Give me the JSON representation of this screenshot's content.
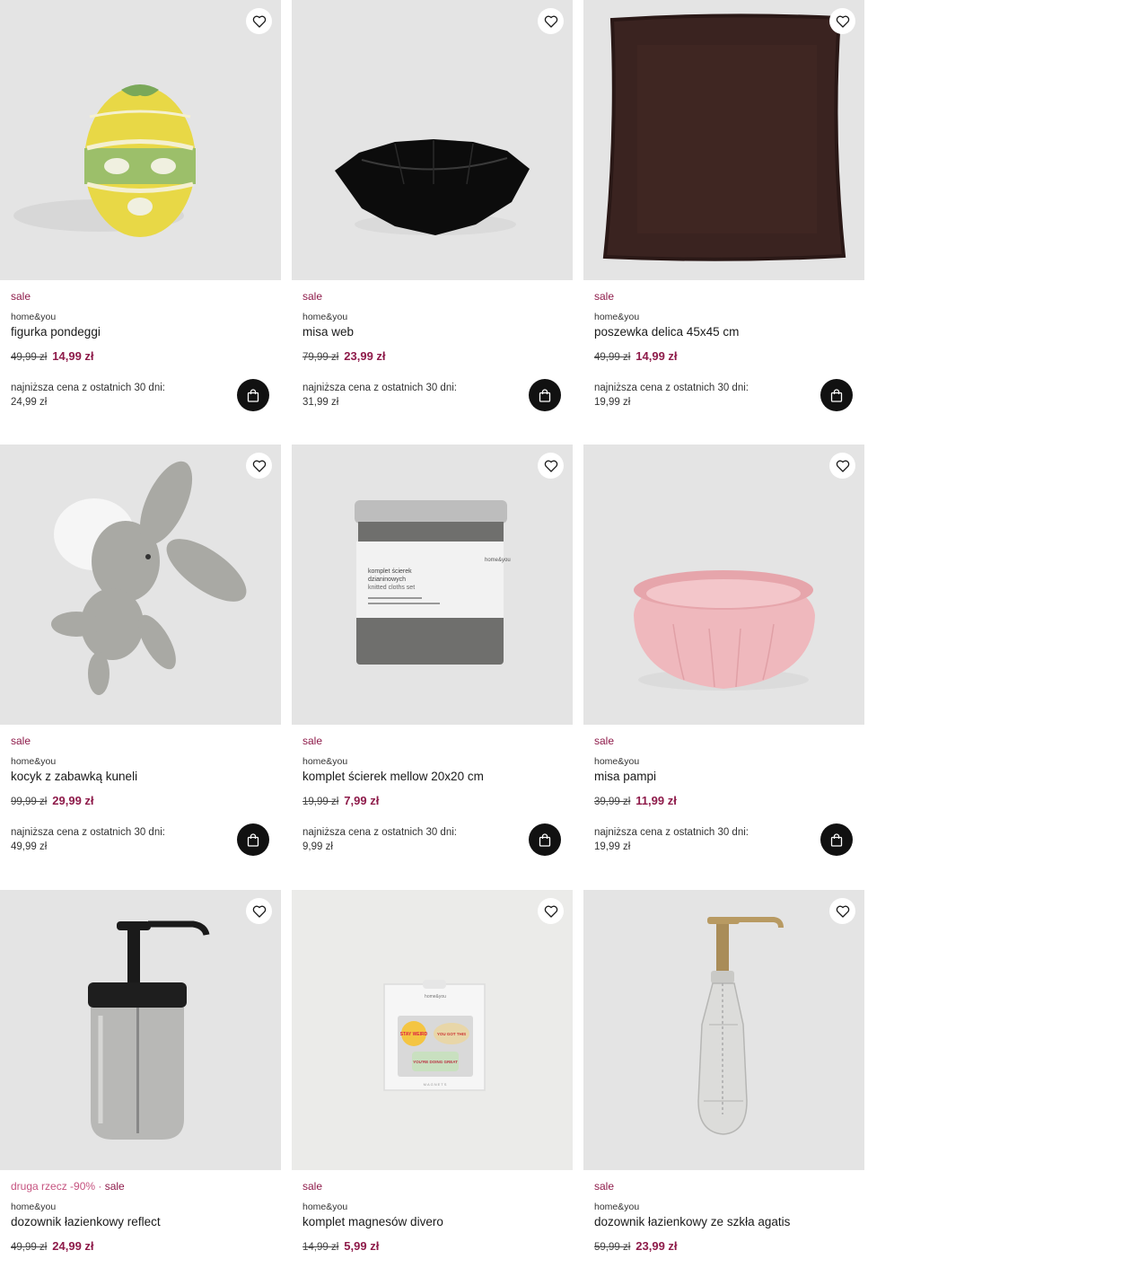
{
  "colors": {
    "accent": "#8e1b4a",
    "promo_light": "#c5527f",
    "card_bg": "#e4e4e4",
    "cart_button": "#111111"
  },
  "products": [
    {
      "promo_primary": "sale",
      "promo_secondary": "",
      "brand": "home&you",
      "name": "figurka pondeggi",
      "old_price": "49,99 zł",
      "new_price": "14,99 zł",
      "lowest_label": "najniższa cena z ostatnich 30 dni:",
      "lowest_price": "24,99 zł",
      "image_icon": "easter-egg-figurine-image"
    },
    {
      "promo_primary": "sale",
      "promo_secondary": "",
      "brand": "home&you",
      "name": "misa web",
      "old_price": "79,99 zł",
      "new_price": "23,99 zł",
      "lowest_label": "najniższa cena z ostatnich 30 dni:",
      "lowest_price": "31,99 zł",
      "image_icon": "black-bowl-image"
    },
    {
      "promo_primary": "sale",
      "promo_secondary": "",
      "brand": "home&you",
      "name": "poszewka delica 45x45 cm",
      "old_price": "49,99 zł",
      "new_price": "14,99 zł",
      "lowest_label": "najniższa cena z ostatnich 30 dni:",
      "lowest_price": "19,99 zł",
      "image_icon": "brown-pillow-image"
    },
    {
      "promo_primary": "sale",
      "promo_secondary": "",
      "brand": "home&you",
      "name": "kocyk z zabawką kuneli",
      "old_price": "99,99 zł",
      "new_price": "29,99 zł",
      "lowest_label": "najniższa cena z ostatnich 30 dni:",
      "lowest_price": "49,99 zł",
      "image_icon": "plush-bunny-blanket-image"
    },
    {
      "promo_primary": "sale",
      "promo_secondary": "",
      "brand": "home&you",
      "name": "komplet ścierek mellow 20x20 cm",
      "old_price": "19,99 zł",
      "new_price": "7,99 zł",
      "lowest_label": "najniższa cena z ostatnich 30 dni:",
      "lowest_price": "9,99 zł",
      "image_icon": "knitted-cloths-image",
      "package": {
        "brand": "home&you",
        "line1": "komplet ścierek",
        "line2": "dzianinowych",
        "line3": "knitted cloths set"
      }
    },
    {
      "promo_primary": "sale",
      "promo_secondary": "",
      "brand": "home&you",
      "name": "misa pampi",
      "old_price": "39,99 zł",
      "new_price": "11,99 zł",
      "lowest_label": "najniższa cena z ostatnich 30 dni:",
      "lowest_price": "19,99 zł",
      "image_icon": "pink-bowl-image"
    },
    {
      "promo_primary": "sale",
      "promo_secondary": "druga rzecz -90% · ",
      "brand": "home&you",
      "name": "dozownik łazienkowy reflect",
      "old_price": "49,99 zł",
      "new_price": "24,99 zł",
      "lowest_label": "",
      "lowest_price": "",
      "image_icon": "black-soap-dispenser-image"
    },
    {
      "promo_primary": "sale",
      "promo_secondary": "",
      "brand": "home&you",
      "name": "komplet magnesów divero",
      "old_price": "14,99 zł",
      "new_price": "5,99 zł",
      "lowest_label": "",
      "lowest_price": "",
      "image_icon": "magnets-set-image",
      "package": {
        "brand": "home&you",
        "m1": "STAY WEIRD",
        "m2": "YOU GOT THIS",
        "m3": "YOU'RE DOING GREAT",
        "footer": "MAGNETS"
      }
    },
    {
      "promo_primary": "sale",
      "promo_secondary": "",
      "brand": "home&you",
      "name": "dozownik łazienkowy ze szkła agatis",
      "old_price": "59,99 zł",
      "new_price": "23,99 zł",
      "lowest_label": "",
      "lowest_price": "",
      "image_icon": "glass-soap-dispenser-image"
    }
  ]
}
